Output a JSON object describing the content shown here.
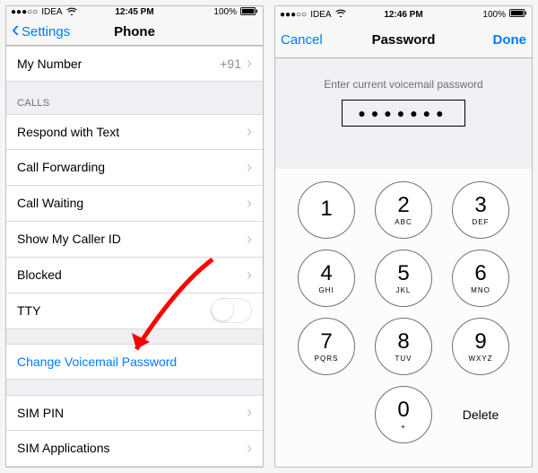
{
  "left": {
    "status": {
      "carrier": "IDEA",
      "time": "12:45 PM",
      "battery": "100%"
    },
    "nav": {
      "back": "Settings",
      "title": "Phone"
    },
    "my_number": {
      "label": "My Number",
      "value": "+91"
    },
    "calls_header": "CALLS",
    "rows": {
      "respond": "Respond with Text",
      "forwarding": "Call Forwarding",
      "waiting": "Call Waiting",
      "caller_id": "Show My Caller ID",
      "blocked": "Blocked",
      "tty": "TTY",
      "change_vm": "Change Voicemail Password",
      "sim_pin": "SIM PIN",
      "sim_apps": "SIM Applications"
    }
  },
  "right": {
    "status": {
      "carrier": "IDEA",
      "time": "12:46 PM",
      "battery": "100%"
    },
    "nav": {
      "cancel": "Cancel",
      "title": "Password",
      "done": "Done"
    },
    "prompt": "Enter current voicemail password",
    "dots": "●●●●●●●",
    "keys": {
      "1": {
        "n": "1",
        "s": ""
      },
      "2": {
        "n": "2",
        "s": "ABC"
      },
      "3": {
        "n": "3",
        "s": "DEF"
      },
      "4": {
        "n": "4",
        "s": "GHI"
      },
      "5": {
        "n": "5",
        "s": "JKL"
      },
      "6": {
        "n": "6",
        "s": "MNO"
      },
      "7": {
        "n": "7",
        "s": "PQRS"
      },
      "8": {
        "n": "8",
        "s": "TUV"
      },
      "9": {
        "n": "9",
        "s": "WXYZ"
      },
      "0": {
        "n": "0",
        "s": "+"
      }
    },
    "delete": "Delete"
  }
}
